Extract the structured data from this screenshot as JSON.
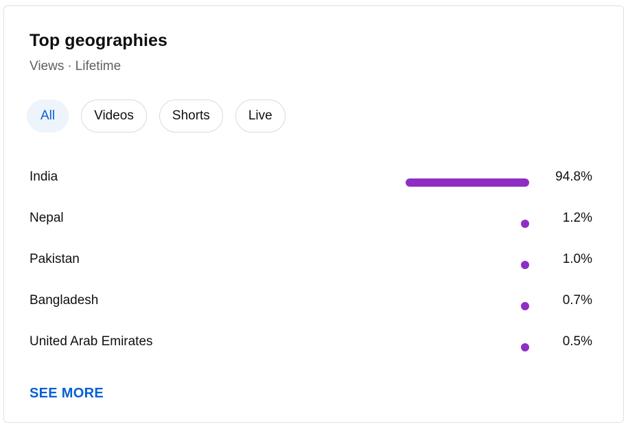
{
  "card": {
    "title": "Top geographies",
    "subtitle_metric": "Views",
    "subtitle_separator": "·",
    "subtitle_period": "Lifetime"
  },
  "chips": [
    {
      "label": "All",
      "active": true
    },
    {
      "label": "Videos",
      "active": false
    },
    {
      "label": "Shorts",
      "active": false
    },
    {
      "label": "Live",
      "active": false
    }
  ],
  "colors": {
    "bar": "#8e2ec4",
    "link": "#065fd4",
    "active_chip_bg": "#eef4fb"
  },
  "geographies": [
    {
      "name": "India",
      "value": "94.8%",
      "fraction": 0.948
    },
    {
      "name": "Nepal",
      "value": "1.2%",
      "fraction": 0.012
    },
    {
      "name": "Pakistan",
      "value": "1.0%",
      "fraction": 0.01
    },
    {
      "name": "Bangladesh",
      "value": "0.7%",
      "fraction": 0.007
    },
    {
      "name": "United Arab Emirates",
      "value": "0.5%",
      "fraction": 0.005
    }
  ],
  "see_more_label": "SEE MORE"
}
